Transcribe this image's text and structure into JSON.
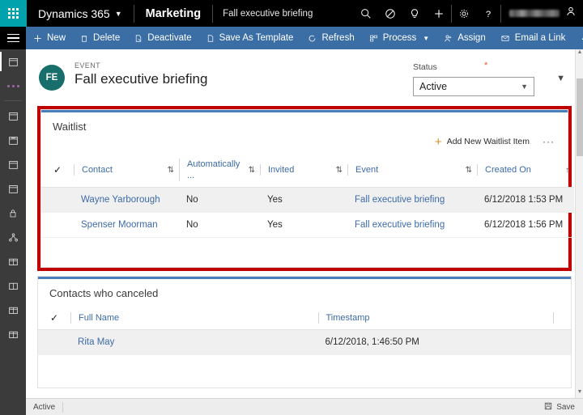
{
  "topbar": {
    "waffle_icon": "app-launcher-icon",
    "brand": "Dynamics 365",
    "brand_chevron": "chevron-down-icon",
    "app_name": "Marketing",
    "record_name": "Fall executive briefing",
    "icons": [
      "search-icon",
      "filter-icon",
      "lightbulb-icon",
      "plus-icon",
      "gear-icon",
      "help-icon"
    ],
    "user_name": ""
  },
  "rail": {
    "menu_icon": "hamburger-menu-icon",
    "items": [
      {
        "icon": "calendar-icon",
        "name": "rail-item-recent"
      },
      {
        "icon": "ellipsis-icon",
        "name": "rail-item-more"
      },
      {
        "icon": "calendar-icon",
        "name": "rail-item-events-1"
      },
      {
        "icon": "calendar-icon",
        "name": "rail-item-events-2"
      },
      {
        "icon": "calendar-icon",
        "name": "rail-item-events-3"
      },
      {
        "icon": "calendar-icon",
        "name": "rail-item-events-4"
      },
      {
        "icon": "lock-icon",
        "name": "rail-item-security"
      },
      {
        "icon": "network-icon",
        "name": "rail-item-network"
      },
      {
        "icon": "card-icon",
        "name": "rail-item-card-1"
      },
      {
        "icon": "card-icon",
        "name": "rail-item-card-2"
      },
      {
        "icon": "card-icon",
        "name": "rail-item-card-3"
      },
      {
        "icon": "card-icon",
        "name": "rail-item-card-4"
      }
    ]
  },
  "commandbar": {
    "items": [
      {
        "label": "New",
        "icon": "plus-icon"
      },
      {
        "label": "Delete",
        "icon": "trash-icon"
      },
      {
        "label": "Deactivate",
        "icon": "deactivate-icon"
      },
      {
        "label": "Save As Template",
        "icon": "document-icon"
      },
      {
        "label": "Refresh",
        "icon": "refresh-icon"
      },
      {
        "label": "Process",
        "icon": "process-icon",
        "chevron": "chevron-down-icon"
      },
      {
        "label": "Assign",
        "icon": "assign-person-icon"
      },
      {
        "label": "Email a Link",
        "icon": "email-link-icon"
      }
    ],
    "overflow": "···"
  },
  "form": {
    "avatar_initials": "FE",
    "kicker": "EVENT",
    "title": "Fall executive briefing",
    "status_label": "Status",
    "required_marker": "*",
    "status_value": "Active",
    "status_chevron": "chevron-down-icon",
    "header_chevron": "chevron-down-icon"
  },
  "waitlist": {
    "title": "Waitlist",
    "add_button": "Add New Waitlist Item",
    "add_icon": "plus-icon",
    "overflow": "···",
    "select_all_icon": "checkmark-icon",
    "sort_icon": "sort-updown-icon",
    "sort_asc_icon": "sort-up-icon",
    "columns": [
      "Contact",
      "Automatically ...",
      "Invited",
      "Event",
      "Created On"
    ],
    "rows": [
      {
        "contact": "Wayne Yarborough",
        "automatically": "No",
        "invited": "Yes",
        "event": "Fall executive briefing",
        "created_on": "6/12/2018 1:53 PM"
      },
      {
        "contact": "Spenser Moorman",
        "automatically": "No",
        "invited": "Yes",
        "event": "Fall executive briefing",
        "created_on": "6/12/2018 1:56 PM"
      }
    ]
  },
  "canceled": {
    "title": "Contacts who canceled",
    "select_all_icon": "checkmark-icon",
    "columns": [
      "Full Name",
      "Timestamp"
    ],
    "rows": [
      {
        "full_name": "Rita May",
        "timestamp": "6/12/2018, 1:46:50 PM"
      }
    ]
  },
  "footer": {
    "status": "Active",
    "save_label": "Save",
    "save_icon": "save-disk-icon"
  },
  "colors": {
    "accent_teal": "#00a2ad",
    "command_blue": "#3b6ea5",
    "link_blue": "#3d6ba8",
    "highlight_red": "#c00000",
    "avatar_teal": "#186e6b",
    "required_orange": "#e8532c"
  }
}
